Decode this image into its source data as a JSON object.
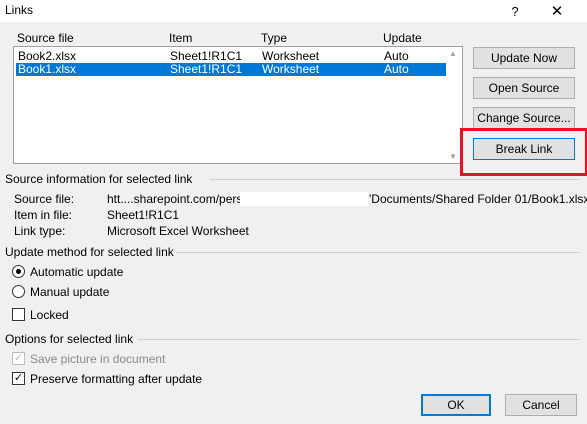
{
  "window": {
    "title": "Links",
    "help_label": "?",
    "close_label": "✕"
  },
  "list": {
    "headers": [
      "Source file",
      "Item",
      "Type",
      "Update"
    ],
    "rows": [
      {
        "source": "Book2.xlsx",
        "item": "Sheet1!R1C1",
        "type": "Worksheet",
        "update": "Auto",
        "selected": false
      },
      {
        "source": "Book1.xlsx",
        "item": "Sheet1!R1C1",
        "type": "Worksheet",
        "update": "Auto",
        "selected": true
      }
    ]
  },
  "buttons": {
    "update_now": "Update Now",
    "open_source": "Open Source",
    "change_source": "Change Source...",
    "break_link": "Break Link",
    "ok": "OK",
    "cancel": "Cancel"
  },
  "source_info": {
    "heading": "Source information for selected link",
    "source_file_label": "Source file:",
    "source_file_value": "htt....sharepoint.com/personal",
    "source_file_tail": "'Documents/Shared Folder 01/Book1.xlsx",
    "item_label": "Item in file:",
    "item_value": "Sheet1!R1C1",
    "type_label": "Link type:",
    "type_value": "Microsoft Excel Worksheet"
  },
  "update_method": {
    "heading": "Update method for selected link",
    "automatic": "Automatic update",
    "manual": "Manual update",
    "selected": "automatic",
    "locked": "Locked"
  },
  "options": {
    "heading": "Options for selected link",
    "save_picture": "Save picture in document",
    "save_picture_checked": true,
    "save_picture_disabled": true,
    "preserve": "Preserve formatting after update",
    "preserve_checked": true
  },
  "colors": {
    "selection": "#0078d7",
    "highlight_box": "#e81123"
  }
}
